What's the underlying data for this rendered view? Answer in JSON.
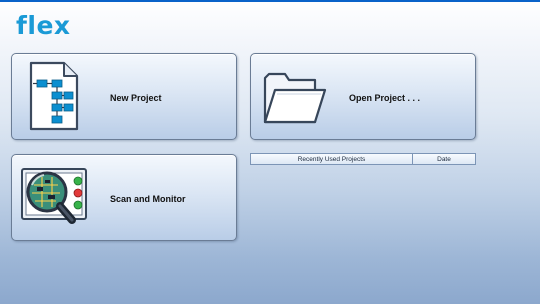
{
  "app": {
    "logo_text": "flex",
    "brand_color": "#1a9ad6"
  },
  "tiles": {
    "new_project": {
      "label": "New Project",
      "icon": "flowchart-document-icon"
    },
    "open_project": {
      "label": "Open Project . . .",
      "icon": "folder-icon"
    },
    "scan_monitor": {
      "label": "Scan and Monitor",
      "icon": "magnifier-circuit-board-icon"
    }
  },
  "recent_projects": {
    "columns": [
      "Recently Used Projects",
      "Date"
    ],
    "rows": []
  }
}
